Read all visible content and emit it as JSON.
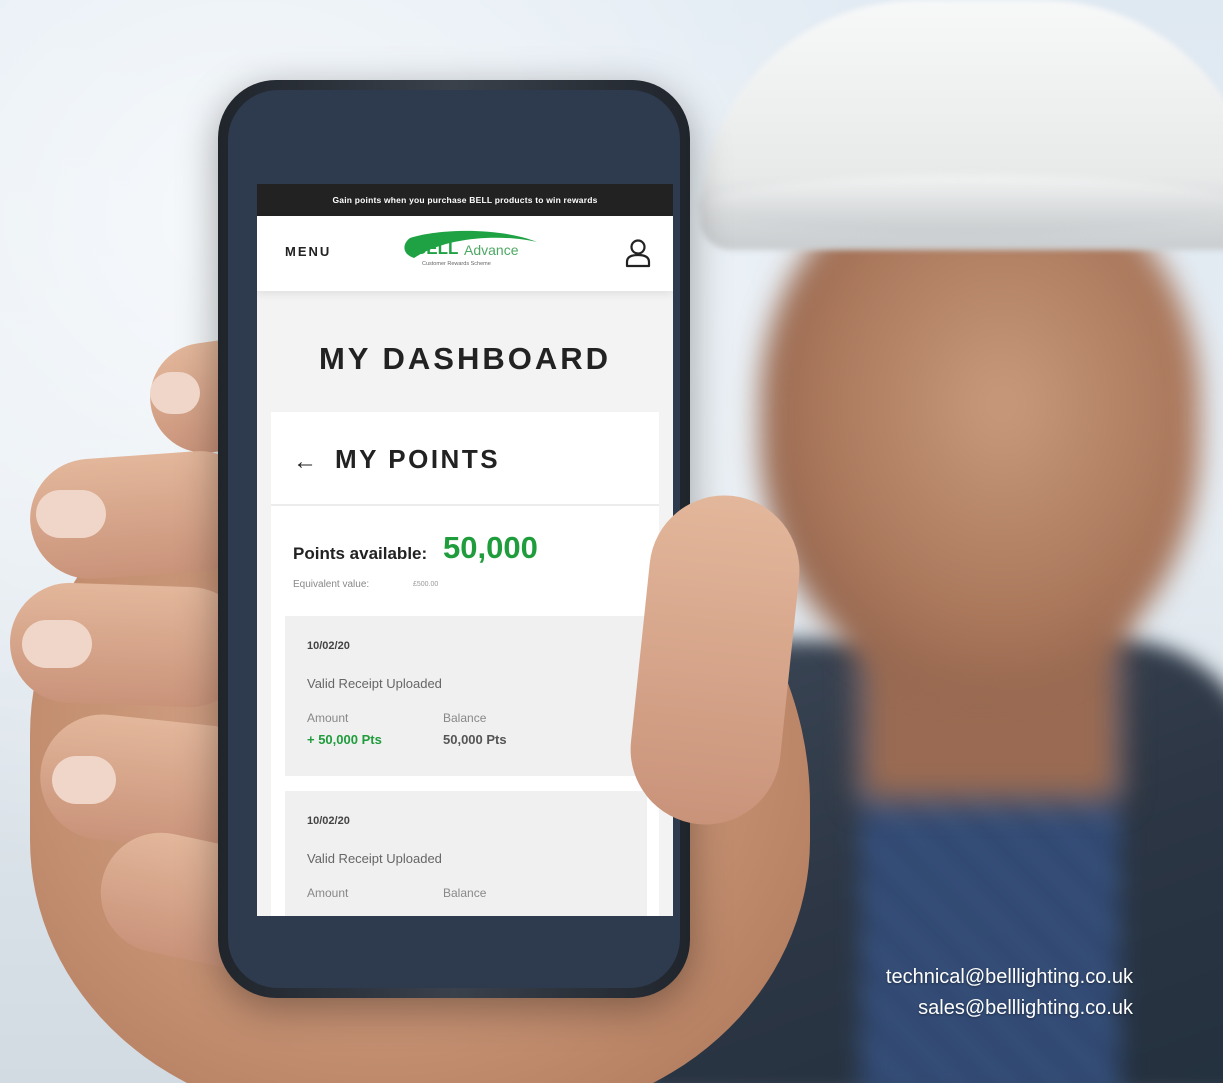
{
  "promo_bar": {
    "text": "Gain points when you purchase BELL products to win rewards"
  },
  "header": {
    "menu_label": "MENU",
    "logo": {
      "brand": "BELL",
      "sub_brand": "Advance",
      "tagline": "Customer Rewards Scheme"
    },
    "account_icon": "user-icon"
  },
  "page": {
    "title": "MY DASHBOARD",
    "section_title": "MY POINTS",
    "back_icon": "arrow-left-icon"
  },
  "points": {
    "label": "Points available:",
    "value": "50,000",
    "equivalent_label": "Equivalent value:",
    "equivalent_value": "£500.00"
  },
  "transactions": [
    {
      "date": "10/02/20",
      "description": "Valid Receipt Uploaded",
      "amount_label": "Amount",
      "balance_label": "Balance",
      "amount": "+ 50,000 Pts",
      "balance": "50,000 Pts"
    },
    {
      "date": "10/02/20",
      "description": "Valid Receipt Uploaded",
      "amount_label": "Amount",
      "balance_label": "Balance"
    }
  ],
  "contact": {
    "technical_email": "technical@belllighting.co.uk",
    "sales_email": "sales@belllighting.co.uk"
  },
  "colors": {
    "brand_green": "#1f9c3c",
    "promo_bar": "#222222"
  }
}
